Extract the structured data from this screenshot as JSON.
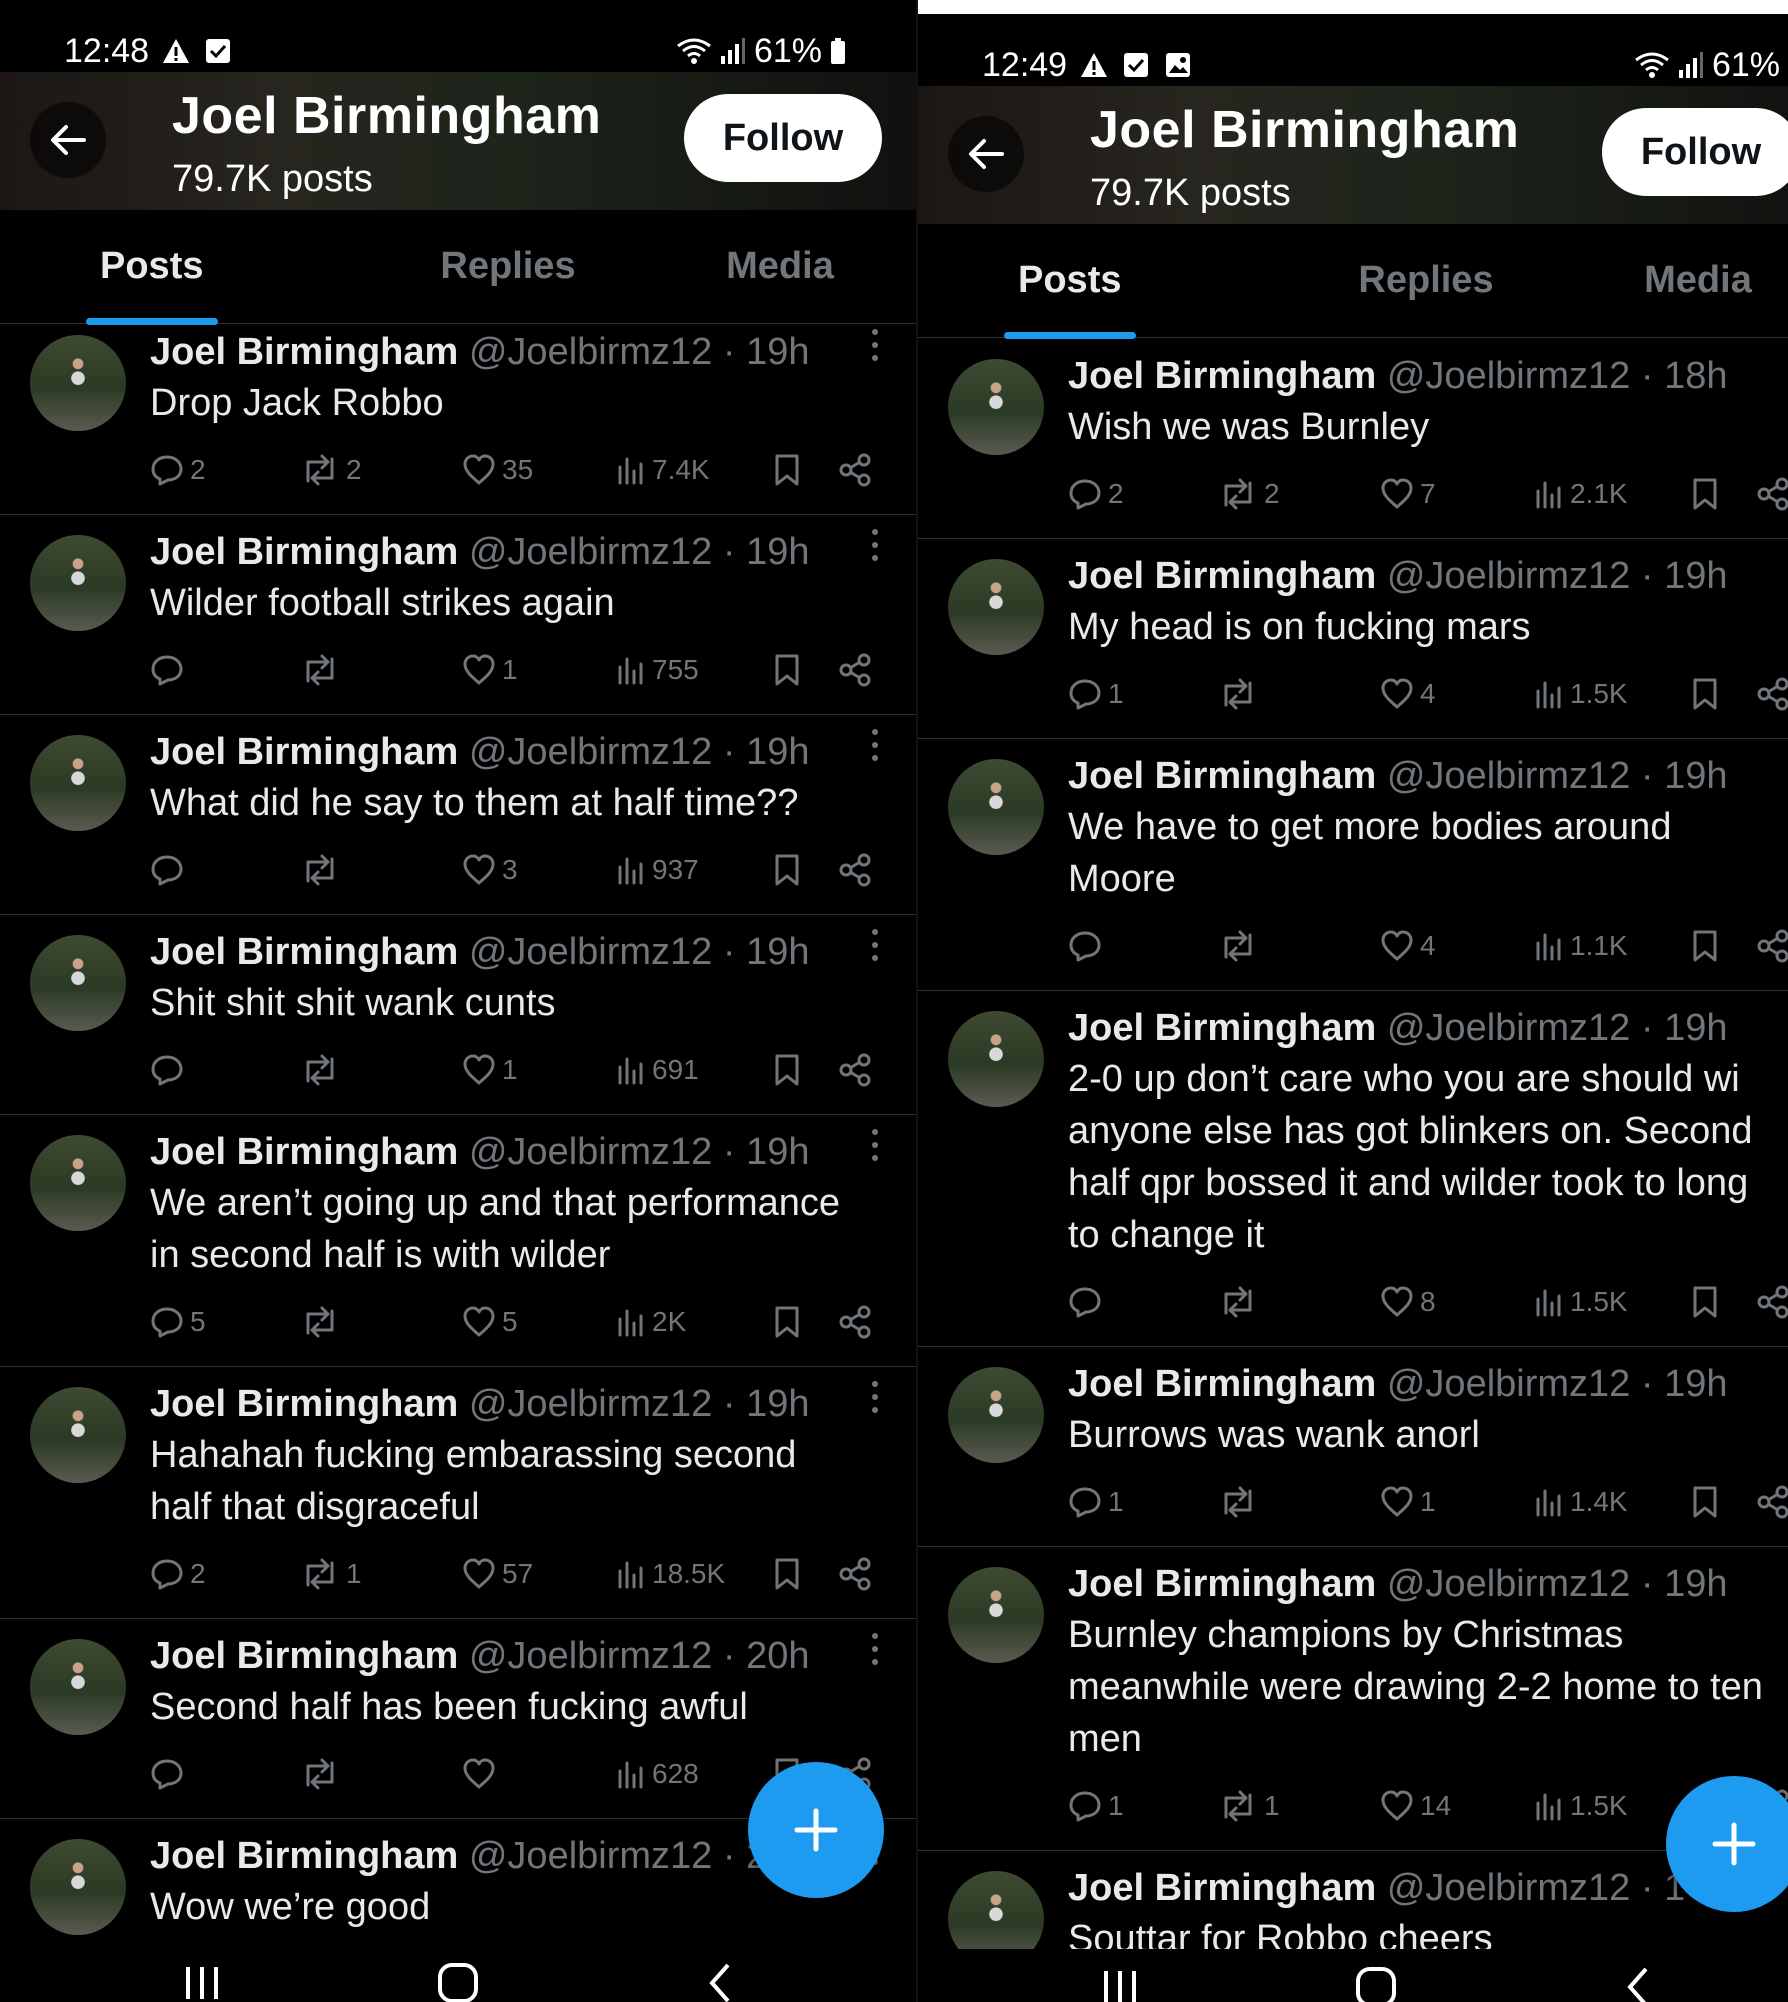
{
  "left": {
    "status": {
      "time": "12:48",
      "battery": "61%"
    },
    "header": {
      "name": "Joel Birmingham",
      "posts": "79.7K posts",
      "follow": "Follow"
    },
    "tabs": [
      "Posts",
      "Replies",
      "Media"
    ],
    "posts": [
      {
        "name": "Joel Birmingham",
        "handle": "@Joelbirmz12 · 19h",
        "lines": [
          "Drop Jack Robbo"
        ],
        "replies": "2",
        "reposts": "2",
        "likes": "35",
        "views": "7.4K"
      },
      {
        "name": "Joel Birmingham",
        "handle": "@Joelbirmz12 · 19h",
        "lines": [
          "Wilder football strikes again"
        ],
        "replies": "",
        "reposts": "",
        "likes": "1",
        "views": "755"
      },
      {
        "name": "Joel Birmingham",
        "handle": "@Joelbirmz12 · 19h",
        "lines": [
          "What did he say to them at half time??"
        ],
        "replies": "",
        "reposts": "",
        "likes": "3",
        "views": "937"
      },
      {
        "name": "Joel Birmingham",
        "handle": "@Joelbirmz12 · 19h",
        "lines": [
          "Shit shit shit wank cunts"
        ],
        "replies": "",
        "reposts": "",
        "likes": "1",
        "views": "691"
      },
      {
        "name": "Joel Birmingham",
        "handle": "@Joelbirmz12 · 19h",
        "lines": [
          "We aren’t going up and that performance",
          "in second half is with wilder"
        ],
        "replies": "5",
        "reposts": "",
        "likes": "5",
        "views": "2K"
      },
      {
        "name": "Joel Birmingham",
        "handle": "@Joelbirmz12 · 19h",
        "lines": [
          "Hahahah fucking embarassing second",
          "half that disgraceful"
        ],
        "replies": "2",
        "reposts": "1",
        "likes": "57",
        "views": "18.5K"
      },
      {
        "name": "Joel Birmingham",
        "handle": "@Joelbirmz12 · 20h",
        "lines": [
          "Second half has been fucking awful"
        ],
        "replies": "",
        "reposts": "",
        "likes": "",
        "views": "628"
      },
      {
        "name": "Joel Birmingham",
        "handle": "@Joelbirmz12 · 2",
        "lines": [
          "Wow we’re good"
        ],
        "replies": "",
        "reposts": "",
        "likes": "",
        "views": ""
      }
    ]
  },
  "right": {
    "status": {
      "time": "12:49",
      "battery": "61%"
    },
    "header": {
      "name": "Joel Birmingham",
      "posts": "79.7K posts",
      "follow": "Follow"
    },
    "tabs": [
      "Posts",
      "Replies",
      "Media"
    ],
    "posts": [
      {
        "name": "Joel Birmingham",
        "handle": "@Joelbirmz12 · 18h",
        "lines": [
          "Wish we was Burnley"
        ],
        "replies": "2",
        "reposts": "2",
        "likes": "7",
        "views": "2.1K"
      },
      {
        "name": "Joel Birmingham",
        "handle": "@Joelbirmz12 · 19h",
        "lines": [
          "My head is on fucking mars"
        ],
        "replies": "1",
        "reposts": "",
        "likes": "4",
        "views": "1.5K"
      },
      {
        "name": "Joel Birmingham",
        "handle": "@Joelbirmz12 · 19h",
        "lines": [
          "We have to get more bodies around",
          "Moore"
        ],
        "replies": "",
        "reposts": "",
        "likes": "4",
        "views": "1.1K"
      },
      {
        "name": "Joel Birmingham",
        "handle": "@Joelbirmz12 · 19h",
        "lines": [
          "2-0 up don’t care who you are should wi",
          "anyone else has got blinkers on. Second",
          "half qpr bossed it and wilder took to long",
          "to change it"
        ],
        "replies": "",
        "reposts": "",
        "likes": "8",
        "views": "1.5K"
      },
      {
        "name": "Joel Birmingham",
        "handle": "@Joelbirmz12 · 19h",
        "lines": [
          "Burrows was wank anorl"
        ],
        "replies": "1",
        "reposts": "",
        "likes": "1",
        "views": "1.4K"
      },
      {
        "name": "Joel Birmingham",
        "handle": "@Joelbirmz12 · 19h",
        "lines": [
          "Burnley champions by Christmas",
          "meanwhile were drawing 2-2 home to ten",
          "men"
        ],
        "replies": "1",
        "reposts": "1",
        "likes": "14",
        "views": "1.5K"
      },
      {
        "name": "Joel Birmingham",
        "handle": "@Joelbirmz12 · 1",
        "lines": [
          "Souttar for Robbo cheers"
        ],
        "replies": "",
        "reposts": "",
        "likes": "",
        "views": ""
      }
    ]
  },
  "icons": {
    "back": "arrow-left-icon",
    "reply": "reply-icon",
    "repost": "repost-icon",
    "like": "heart-icon",
    "views": "views-icon",
    "bookmark": "bookmark-icon",
    "share": "share-icon",
    "compose": "plus-icon"
  },
  "colors": {
    "accent": "#1d9bf0",
    "muted": "#71767b",
    "text": "#e7e9ea",
    "bg": "#000000"
  }
}
